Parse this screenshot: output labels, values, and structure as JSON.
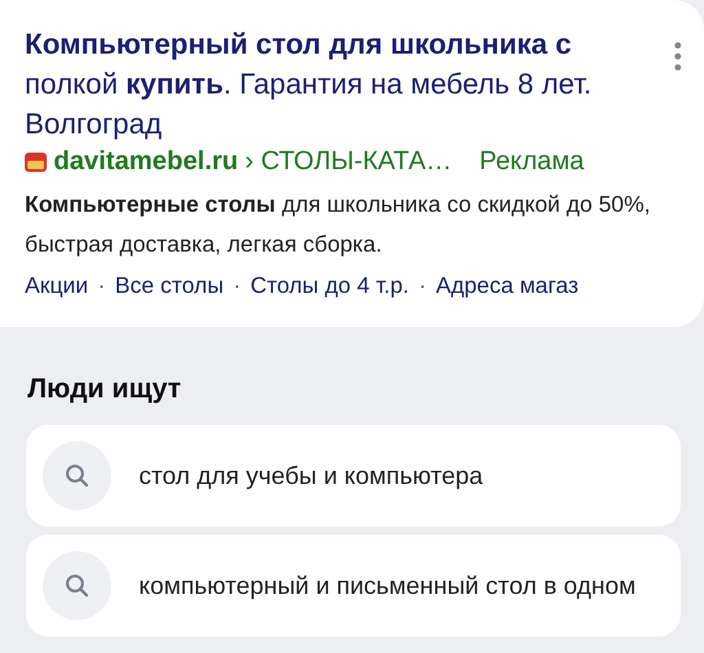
{
  "ad": {
    "title": "**Компьютерный стол для школьника с** полкой **купить**. Гарантия на мебель 8 лет. Волгоград",
    "domain": "davitamebel.ru",
    "path": "› СТОЛЫ-КАТА…",
    "ad_label": "Реклама",
    "description": "**Компьютерные столы** для школьника со скидкой до 50%, быстрая доставка, легкая сборка.",
    "separator": "·",
    "sitelinks": [
      "Акции",
      "Все столы",
      "Столы до 4 т.р.",
      "Адреса магаз"
    ]
  },
  "people_search": {
    "heading": "Люди ищут",
    "items": [
      {
        "text": "стол для учебы и компьютера"
      },
      {
        "text": "компьютерный и письменный стол в одном"
      }
    ]
  }
}
